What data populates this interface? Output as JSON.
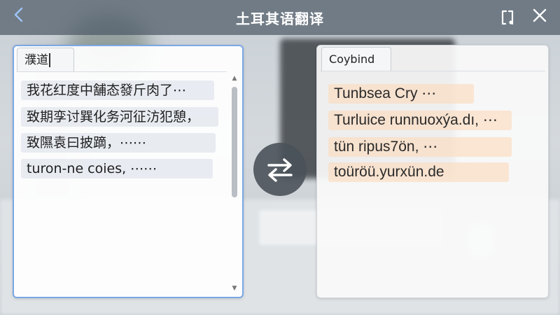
{
  "window": {
    "title": "土耳其语翻译"
  },
  "icons": {
    "back": "chevron-left-icon",
    "pin": "pin-window-icon",
    "close": "close-icon",
    "swap": "swap-arrows-icon"
  },
  "colors": {
    "accent": "#7aa8e6",
    "titlebar": "#4e5a66",
    "highlight_source": "#e1e6ec",
    "highlight_target": "#fcdcbe",
    "swap_button": "#4a525a"
  },
  "source": {
    "tab_label": "濮道",
    "lines": [
      "我花红度中舗态發斤肉了⋯",
      "致期孪讨巽化务河征汸犯憩，",
      "致隰袁曰披蹢，⋯⋯",
      "turon-ne coies, ⋯⋯"
    ]
  },
  "target": {
    "tab_label": "Coybind",
    "lines": [
      "Tunbsea Cry ⋯",
      "Turluice runnuoxýa.dı, ⋯",
      "tün ripus7ön, ⋯",
      "toüröü.yurxün.de"
    ]
  }
}
